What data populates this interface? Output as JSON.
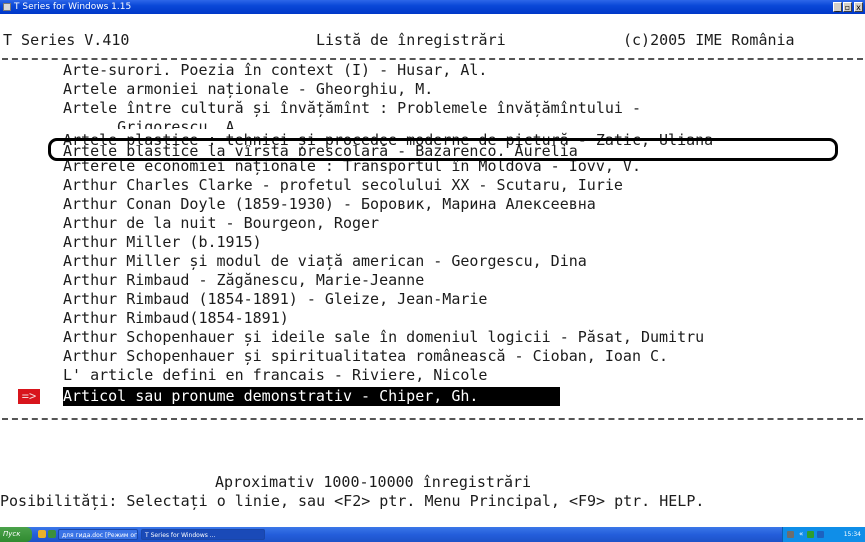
{
  "window": {
    "title": "T Series for Windows 1.15",
    "minimize_glyph": "_",
    "maximize_glyph": "▫",
    "close_glyph": "x"
  },
  "header": {
    "app_version": "T Series V.410",
    "screen_title": "Listă de înregistrări",
    "copyright": "(c)2005 IME România"
  },
  "records": [
    "Arte-surori. Poezia în context (I) - Husar, Al.",
    "Artele armoniei naționale - Gheorghiu, M.",
    "Artele între cultură și învățămînt : Problemele învățămîntului -",
    "      Grigorescu, A.",
    "Artele plastice : tehnici și procedee moderne de pictură - Zatic, Uliana",
    "Artele plastice la vîrsta preșcolară - Bazarenco, Aurelia",
    "Arterele economiei naționale : Transportul în Moldova - Iovv, V.",
    "Arthur Charles Clarke - profetul secolului XX - Scutaru, Iurie",
    "Arthur Conan Doyle (1859-1930) - Боровик, Марина Алексеевна",
    "Arthur de la nuit - Bourgeon, Roger",
    "Arthur Miller (b.1915)",
    "Arthur Miller și modul de viață american - Georgescu, Dina",
    "Arthur Rimbaud - Zăgănescu, Marie-Jeanne",
    "Arthur Rimbaud (1854-1891) - Gleize, Jean-Marie",
    "Arthur Rimbaud(1854-1891)",
    "Arthur Schopenhauer și ideile sale în domeniul logicii - Păsat, Dumitru",
    "Arthur Schopenhauer și spiritualitatea românească - Cioban, Ioan C.",
    "L' article defini en francais - Riviere, Nicole"
  ],
  "selected_record": "Articol sau pronume demonstrativ - Chiper, Gh.",
  "cursor_marker": "=>",
  "footer": {
    "record_count": "Aproximativ 1000-10000 înregistrări",
    "help_line": "Posibilități: Selectați o linie, sau <F2> ptr. Menu Principal, <F9> ptr. HELP."
  },
  "taskbar": {
    "start_label": "Пуск",
    "task1": "для гида.doc [Режим ог...",
    "task2": "T Series for Windows ...",
    "tray_lang": "«",
    "clock": "15:34"
  },
  "colors": {
    "titlebar": "#0a48d8",
    "highlight_border": "#000000",
    "cursor_marker_bg": "#d8151c",
    "selection_bg": "#000000",
    "taskbar": "#245edb"
  }
}
